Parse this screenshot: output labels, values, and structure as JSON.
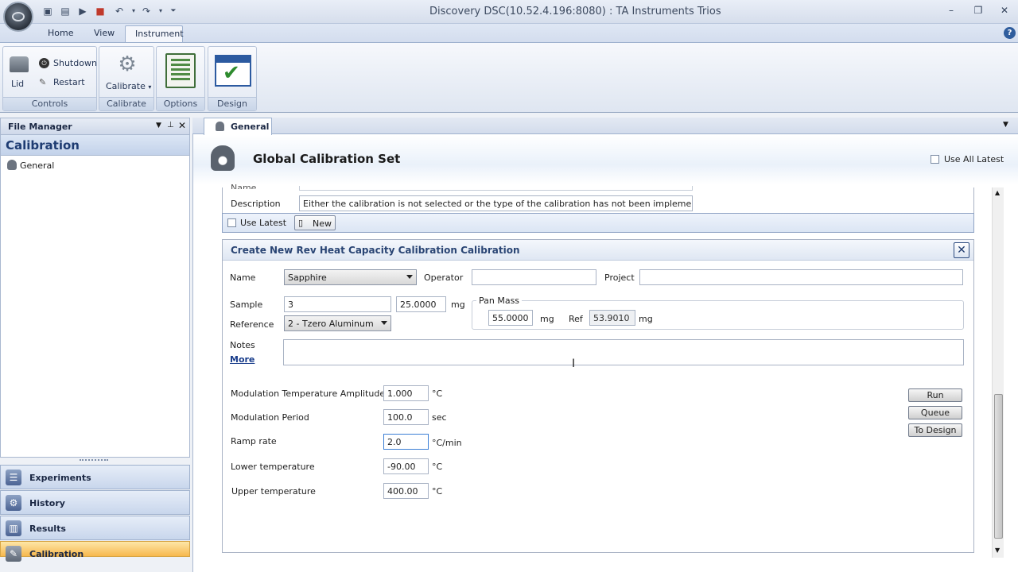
{
  "window": {
    "title": "Discovery DSC(10.52.4.196:8080) : TA Instruments Trios"
  },
  "ribbon": {
    "tabs": [
      "Home",
      "View",
      "Instrument"
    ],
    "active_tab": "Instrument",
    "groups": {
      "controls": "Controls",
      "calibrate": "Calibrate",
      "options": "Options",
      "design": "Design"
    },
    "buttons": {
      "lid": "Lid",
      "shutdown": "Shutdown",
      "restart": "Restart",
      "calibrate": "Calibrate"
    }
  },
  "file_manager": {
    "title": "File Manager",
    "section": "Calibration",
    "tree_item": "General",
    "nav": [
      {
        "label": "Experiments",
        "icon": "experiments-icon"
      },
      {
        "label": "History",
        "icon": "history-icon"
      },
      {
        "label": "Results",
        "icon": "results-icon"
      },
      {
        "label": "Calibration",
        "icon": "calibration-icon"
      }
    ],
    "selected_nav": "Calibration"
  },
  "document": {
    "tab": "General",
    "heading": "Global Calibration Set",
    "use_all_latest": "Use All Latest",
    "name_label": "Name",
    "description_label": "Description",
    "description_value": "Either the calibration is not selected or the type of the calibration has not been implemented.",
    "use_latest": "Use Latest",
    "new_button": "New"
  },
  "panel": {
    "title": "Create New Rev Heat Capacity Calibration Calibration",
    "name_label": "Name",
    "name_value": "Sapphire",
    "operator_label": "Operator",
    "operator_value": "",
    "project_label": "Project",
    "project_value": "",
    "sample_label": "Sample",
    "sample_value": "3",
    "sample_mass": "25.0000",
    "sample_unit": "mg",
    "reference_label": "Reference",
    "reference_value": "2 - Tzero Aluminum",
    "pan_mass_label": "Pan Mass",
    "pan_mass_value": "55.0000",
    "pan_unit": "mg",
    "ref_label": "Ref",
    "ref_value": "53.9010",
    "ref_unit": "mg",
    "notes_label": "Notes",
    "more_link": "More",
    "params": [
      {
        "label": "Modulation Temperature Amplitude ±",
        "value": "1.000",
        "unit": "°C"
      },
      {
        "label": "Modulation Period",
        "value": "100.0",
        "unit": "sec"
      },
      {
        "label": "Ramp rate",
        "value": "2.0",
        "unit": "°C/min"
      },
      {
        "label": "Lower temperature",
        "value": "-90.00",
        "unit": "°C"
      },
      {
        "label": "Upper temperature",
        "value": "400.00",
        "unit": "°C"
      }
    ],
    "buttons": {
      "run": "Run",
      "queue": "Queue",
      "to_design": "To Design"
    }
  }
}
